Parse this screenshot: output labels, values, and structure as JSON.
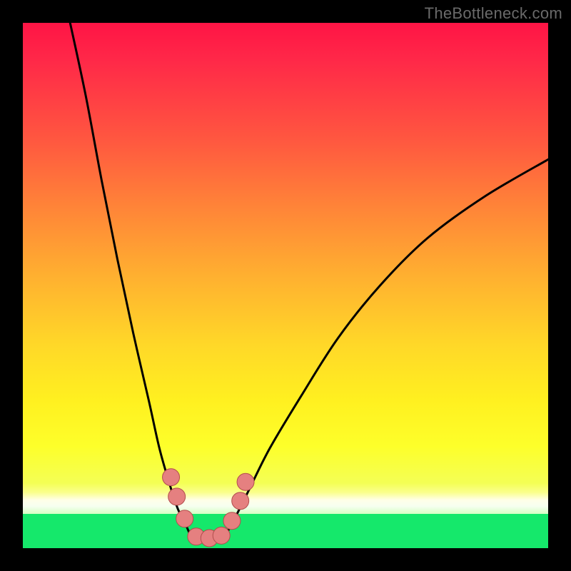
{
  "watermark": {
    "text": "TheBottleneck.com"
  },
  "colors": {
    "background": "#000000",
    "curve": "#000000",
    "marker_fill": "#e58080",
    "marker_stroke": "#b24d4d",
    "green_band": "#15e86b"
  },
  "chart_data": {
    "type": "line",
    "title": "",
    "xlabel": "",
    "ylabel": "",
    "xlim": [
      0,
      100
    ],
    "ylim": [
      0,
      100
    ],
    "note": "Bottleneck-style V curve. Values are estimated screen-space percentages (x: left→right % of plot area, y: bottom→top % of plot area). Minimum at roughly x≈33 where the curve touches 0.",
    "series": [
      {
        "name": "left-branch",
        "x": [
          9,
          12,
          15,
          18,
          21,
          24,
          26,
          28,
          29.5,
          31,
          32,
          33
        ],
        "y": [
          100,
          86,
          70,
          55,
          41,
          28,
          19,
          12,
          7.5,
          4.5,
          2.3,
          1.5
        ]
      },
      {
        "name": "bottom-flat",
        "x": [
          33,
          34,
          35,
          36,
          37,
          38
        ],
        "y": [
          1.5,
          1.3,
          1.2,
          1.2,
          1.3,
          1.5
        ]
      },
      {
        "name": "right-branch",
        "x": [
          38,
          40,
          43,
          47,
          53,
          60,
          68,
          77,
          88,
          100
        ],
        "y": [
          1.5,
          5,
          11,
          19,
          29,
          40,
          50,
          59,
          67,
          74
        ]
      }
    ],
    "markers": {
      "name": "highlight-points",
      "note": "Salmon circular markers clustered near the curve's valley.",
      "points": [
        {
          "x": 28.2,
          "y": 13.5
        },
        {
          "x": 29.3,
          "y": 9.8
        },
        {
          "x": 30.8,
          "y": 5.6
        },
        {
          "x": 33.0,
          "y": 2.2
        },
        {
          "x": 35.5,
          "y": 1.9
        },
        {
          "x": 37.8,
          "y": 2.4
        },
        {
          "x": 39.8,
          "y": 5.2
        },
        {
          "x": 41.4,
          "y": 9.0
        },
        {
          "x": 42.4,
          "y": 12.6
        }
      ],
      "radius_px": 12
    }
  }
}
